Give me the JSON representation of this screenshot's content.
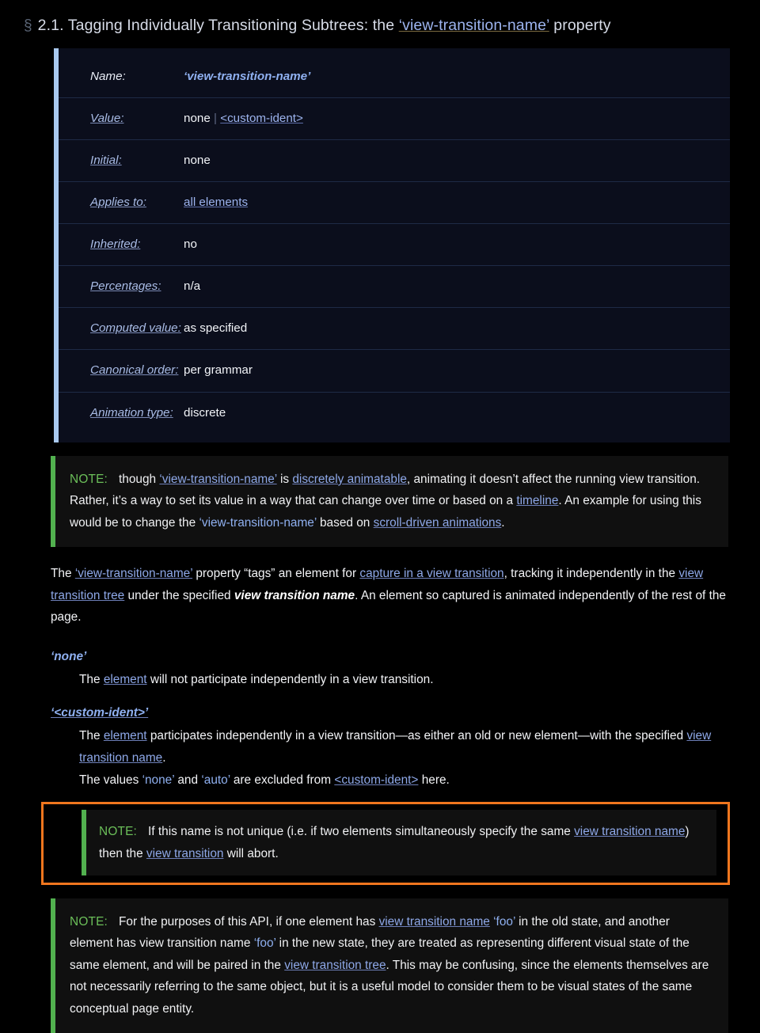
{
  "heading": {
    "mark": "§",
    "number": "2.1.",
    "text_before": "Tagging Individually Transitioning Subtrees: the",
    "property": "‘view-transition-name’",
    "text_after": "property"
  },
  "propdef": {
    "rows": [
      {
        "key": "Name:",
        "key_linked": false,
        "value": "‘view-transition-name’",
        "value_style": "prop-name"
      },
      {
        "key": "Value:",
        "key_linked": true,
        "value": "none | <custom-ident>",
        "value_style": "grammar"
      },
      {
        "key": "Initial:",
        "key_linked": true,
        "value": "none",
        "value_style": "plain"
      },
      {
        "key": "Applies to:",
        "key_linked": true,
        "value": "all elements",
        "value_style": "link"
      },
      {
        "key": "Inherited:",
        "key_linked": true,
        "value": "no",
        "value_style": "plain"
      },
      {
        "key": "Percentages:",
        "key_linked": true,
        "value": "n/a",
        "value_style": "plain"
      },
      {
        "key": "Computed value:",
        "key_linked": true,
        "value": "as specified",
        "value_style": "plain"
      },
      {
        "key": "Canonical order:",
        "key_linked": true,
        "value": "per grammar",
        "value_style": "plain"
      },
      {
        "key": "Animation type:",
        "key_linked": true,
        "value": "discrete",
        "value_style": "plain"
      }
    ],
    "value_tokens": {
      "none": "none",
      "pipe": "|",
      "custom_ident": "<custom-ident>"
    }
  },
  "note1": {
    "label": "NOTE:",
    "seg1": "though",
    "link1": "‘view-transition-name’",
    "seg2": "is",
    "link2": "discretely animatable",
    "seg3": ", animating it doesn’t affect the running view transition. Rather, it’s a way to set its value in a way that can change over time or based on a",
    "link3": "timeline",
    "seg4": ". An example for using this would be to change the",
    "prop": "‘view-transition-name’",
    "seg5": "based on",
    "link4": "scroll-driven animations",
    "seg6": "."
  },
  "para1": {
    "seg1": "The",
    "link1": "‘view-transition-name’",
    "seg2": "property “tags” an element for",
    "link2": "capture in a view transition",
    "seg3": ", tracking it independently in the",
    "link3": "view transition tree",
    "seg4": "under the specified",
    "emph": "view transition name",
    "seg5": ". An element so captured is animated independently of the rest of the page."
  },
  "valdefs": [
    {
      "term": "‘none’",
      "underlined": false,
      "desc_seg1": "The",
      "desc_link": "element",
      "desc_seg2": "will not participate independently in a view transition."
    },
    {
      "term": "‘<custom-ident>’",
      "underlined": true,
      "desc_seg1": "The",
      "desc_link": "element",
      "desc_seg2": "participates independently in a view transition—as either an old or new element—with the specified",
      "desc_link2": "view transition name",
      "desc_seg3": "."
    }
  ],
  "excluded_note": {
    "seg1": "The values",
    "val1": "‘none’",
    "seg2": "and",
    "val2": "‘auto’",
    "seg3": "are excluded from",
    "link": "<custom-ident>",
    "seg4": "here."
  },
  "note2": {
    "label": "NOTE:",
    "seg1": "If this name is not unique (i.e. if two elements simultaneously specify the same",
    "link1": "view transition name",
    "seg2": ") then the",
    "link2": "view transition",
    "seg3": "will abort."
  },
  "note3": {
    "label": "NOTE:",
    "seg1": "For the purposes of this API, if one element has",
    "link1": "view transition name",
    "val1": "‘foo’",
    "seg2": "in the old state, and another element has view transition name",
    "val2": "‘foo’",
    "seg3": "in the new state, they are treated as representing different visual state of the same element, and will be paired in the",
    "link2": "view transition tree",
    "seg4": ". This may be confusing, since the elements themselves are not necessarily referring to the same object, but it is a useful model to consider them to be visual states of the same conceptual page entity."
  },
  "colors": {
    "page_bg": "#000000",
    "table_bg": "#0b0e1c",
    "table_accent": "#a9c9ef",
    "note_bg": "#101010",
    "note_accent": "#52b14f",
    "note_label": "#6bbf59",
    "link": "#8ea8e8",
    "highlight_border": "#f0761e",
    "heading": "#d7dce8"
  }
}
